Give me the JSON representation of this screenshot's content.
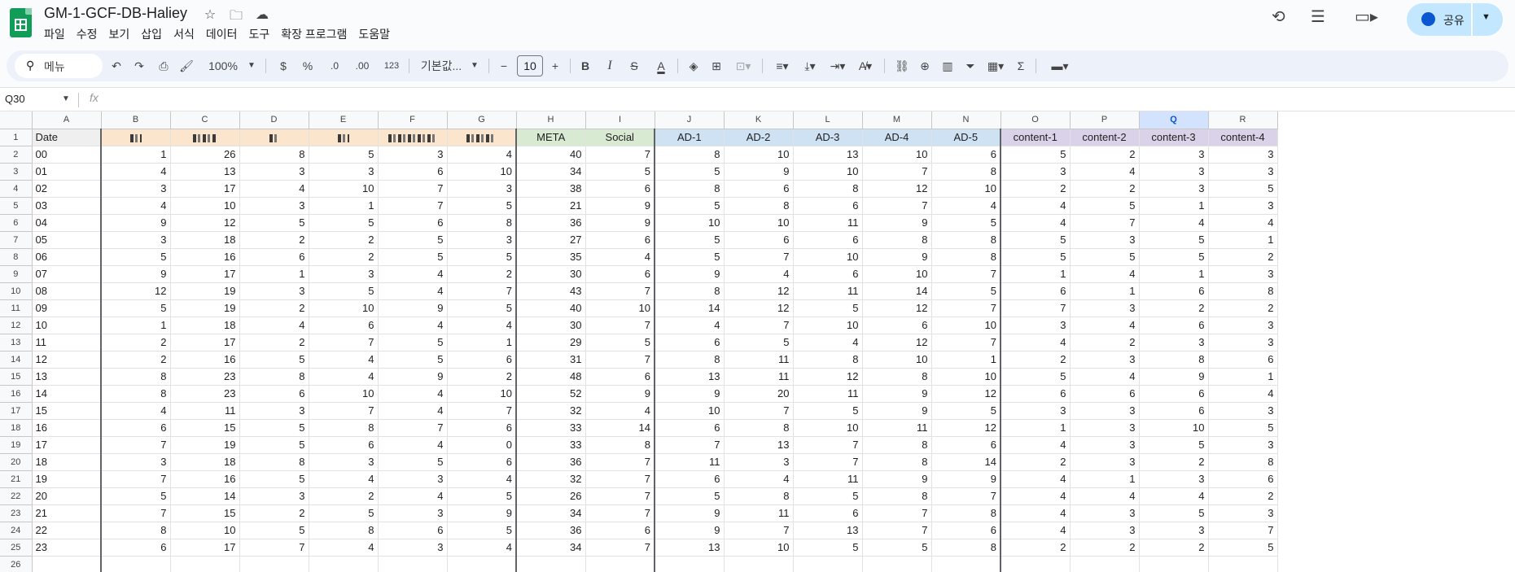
{
  "app": {
    "doc_title": "GM-1-GCF-DB-Haliey",
    "menu": [
      "파일",
      "수정",
      "보기",
      "삽입",
      "서식",
      "데이터",
      "도구",
      "확장 프로그램",
      "도움말"
    ],
    "share_label": "공유"
  },
  "toolbar": {
    "search_label": "메뉴",
    "zoom": "100%",
    "currency": "$",
    "percent": "%",
    "dec_decrease": ".0",
    "dec_increase": ".00",
    "number_format": "123",
    "font_name": "기본값...",
    "font_size": "10",
    "bold": "B",
    "italic": "I",
    "strike": "S",
    "text_color": "A",
    "sum": "Σ"
  },
  "formula_bar": {
    "cell_ref": "Q30",
    "fx": "fx"
  },
  "sheet": {
    "columns": [
      "A",
      "B",
      "C",
      "D",
      "E",
      "F",
      "G",
      "H",
      "I",
      "J",
      "K",
      "L",
      "M",
      "N",
      "O",
      "P",
      "Q",
      "R"
    ],
    "selected_column": "Q",
    "header_row": [
      "Date",
      "",
      "",
      "",
      "",
      "",
      "",
      "META",
      "Social",
      "AD-1",
      "AD-2",
      "AD-3",
      "AD-4",
      "AD-5",
      "content-1",
      "content-2",
      "content-3",
      "content-4"
    ],
    "rows": [
      [
        "00",
        "1",
        "26",
        "8",
        "5",
        "3",
        "4",
        "40",
        "7",
        "8",
        "10",
        "13",
        "10",
        "6",
        "5",
        "2",
        "3",
        "3"
      ],
      [
        "01",
        "4",
        "13",
        "3",
        "3",
        "6",
        "10",
        "34",
        "5",
        "5",
        "9",
        "10",
        "7",
        "8",
        "3",
        "4",
        "3",
        "3"
      ],
      [
        "02",
        "3",
        "17",
        "4",
        "10",
        "7",
        "3",
        "38",
        "6",
        "8",
        "6",
        "8",
        "12",
        "10",
        "2",
        "2",
        "3",
        "5"
      ],
      [
        "03",
        "4",
        "10",
        "3",
        "1",
        "7",
        "5",
        "21",
        "9",
        "5",
        "8",
        "6",
        "7",
        "4",
        "4",
        "5",
        "1",
        "3"
      ],
      [
        "04",
        "9",
        "12",
        "5",
        "5",
        "6",
        "8",
        "36",
        "9",
        "10",
        "10",
        "11",
        "9",
        "5",
        "4",
        "7",
        "4",
        "4"
      ],
      [
        "05",
        "3",
        "18",
        "2",
        "2",
        "5",
        "3",
        "27",
        "6",
        "5",
        "6",
        "6",
        "8",
        "8",
        "5",
        "3",
        "5",
        "1"
      ],
      [
        "06",
        "5",
        "16",
        "6",
        "2",
        "5",
        "5",
        "35",
        "4",
        "5",
        "7",
        "10",
        "9",
        "8",
        "5",
        "5",
        "5",
        "2"
      ],
      [
        "07",
        "9",
        "17",
        "1",
        "3",
        "4",
        "2",
        "30",
        "6",
        "9",
        "4",
        "6",
        "10",
        "7",
        "1",
        "4",
        "1",
        "3"
      ],
      [
        "08",
        "12",
        "19",
        "3",
        "5",
        "4",
        "7",
        "43",
        "7",
        "8",
        "12",
        "11",
        "14",
        "5",
        "6",
        "1",
        "6",
        "8"
      ],
      [
        "09",
        "5",
        "19",
        "2",
        "10",
        "9",
        "5",
        "40",
        "10",
        "14",
        "12",
        "5",
        "12",
        "7",
        "7",
        "3",
        "2",
        "2"
      ],
      [
        "10",
        "1",
        "18",
        "4",
        "6",
        "4",
        "4",
        "30",
        "7",
        "4",
        "7",
        "10",
        "6",
        "10",
        "3",
        "4",
        "6",
        "3"
      ],
      [
        "11",
        "2",
        "17",
        "2",
        "7",
        "5",
        "1",
        "29",
        "5",
        "6",
        "5",
        "4",
        "12",
        "7",
        "4",
        "2",
        "3",
        "3"
      ],
      [
        "12",
        "2",
        "16",
        "5",
        "4",
        "5",
        "6",
        "31",
        "7",
        "8",
        "11",
        "8",
        "10",
        "1",
        "2",
        "3",
        "8",
        "6"
      ],
      [
        "13",
        "8",
        "23",
        "8",
        "4",
        "9",
        "2",
        "48",
        "6",
        "13",
        "11",
        "12",
        "8",
        "10",
        "5",
        "4",
        "9",
        "1"
      ],
      [
        "14",
        "8",
        "23",
        "6",
        "10",
        "4",
        "10",
        "52",
        "9",
        "9",
        "20",
        "11",
        "9",
        "12",
        "6",
        "6",
        "6",
        "4"
      ],
      [
        "15",
        "4",
        "11",
        "3",
        "7",
        "4",
        "7",
        "32",
        "4",
        "10",
        "7",
        "5",
        "9",
        "5",
        "3",
        "3",
        "6",
        "3"
      ],
      [
        "16",
        "6",
        "15",
        "5",
        "8",
        "7",
        "6",
        "33",
        "14",
        "6",
        "8",
        "10",
        "11",
        "12",
        "1",
        "3",
        "10",
        "5"
      ],
      [
        "17",
        "7",
        "19",
        "5",
        "6",
        "4",
        "0",
        "33",
        "8",
        "7",
        "13",
        "7",
        "8",
        "6",
        "4",
        "3",
        "5",
        "3"
      ],
      [
        "18",
        "3",
        "18",
        "8",
        "3",
        "5",
        "6",
        "36",
        "7",
        "11",
        "3",
        "7",
        "8",
        "14",
        "2",
        "3",
        "2",
        "8"
      ],
      [
        "19",
        "7",
        "16",
        "5",
        "4",
        "3",
        "4",
        "32",
        "7",
        "6",
        "4",
        "11",
        "9",
        "9",
        "4",
        "1",
        "3",
        "6"
      ],
      [
        "20",
        "5",
        "14",
        "3",
        "2",
        "4",
        "5",
        "26",
        "7",
        "5",
        "8",
        "5",
        "8",
        "7",
        "4",
        "4",
        "4",
        "2"
      ],
      [
        "21",
        "7",
        "15",
        "2",
        "5",
        "3",
        "9",
        "34",
        "7",
        "9",
        "11",
        "6",
        "7",
        "8",
        "4",
        "3",
        "5",
        "3"
      ],
      [
        "22",
        "8",
        "10",
        "5",
        "8",
        "6",
        "5",
        "36",
        "6",
        "9",
        "7",
        "13",
        "7",
        "6",
        "4",
        "3",
        "3",
        "7"
      ],
      [
        "23",
        "6",
        "17",
        "7",
        "4",
        "3",
        "4",
        "34",
        "7",
        "13",
        "10",
        "5",
        "5",
        "8",
        "2",
        "2",
        "2",
        "5"
      ]
    ],
    "extra_row_number": "26"
  },
  "colors": {
    "accent": "#0b57d0",
    "orange_header": "#fce5cd",
    "green_header": "#d9ead3",
    "blue_header": "#cfe2f3",
    "purple_header": "#d9d2e9"
  }
}
